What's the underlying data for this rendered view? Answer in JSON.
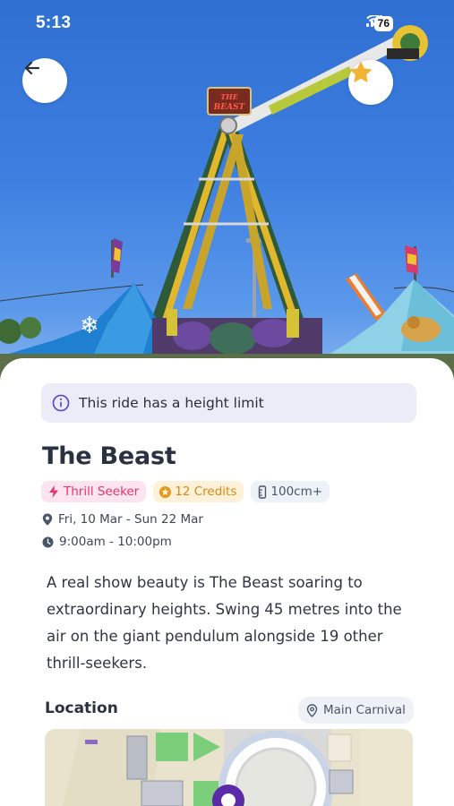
{
  "status_bar": {
    "time": "5:13",
    "battery": "76"
  },
  "hero": {
    "sign_text": "THE BEAST"
  },
  "notice": {
    "text": "This ride has a height limit"
  },
  "ride": {
    "title": "The Beast",
    "tags": {
      "category": "Thrill Seeker",
      "credits": "12 Credits",
      "height": "100cm+"
    },
    "dates": "Fri, 10 Mar - Sun 22 Mar",
    "hours": "9:00am - 10:00pm",
    "description": "A real show beauty is The Beast soaring to extraordinary heights. Swing 45 metres into the air on the giant pendulum alongside 19 other thrill-seekers."
  },
  "location": {
    "label": "Location",
    "area": "Main Carnival"
  },
  "colors": {
    "accent_purple": "#6b4bd8",
    "thrill_pink": "#e4356f",
    "credits_orange": "#d98a10",
    "star_gold": "#f2b233"
  }
}
